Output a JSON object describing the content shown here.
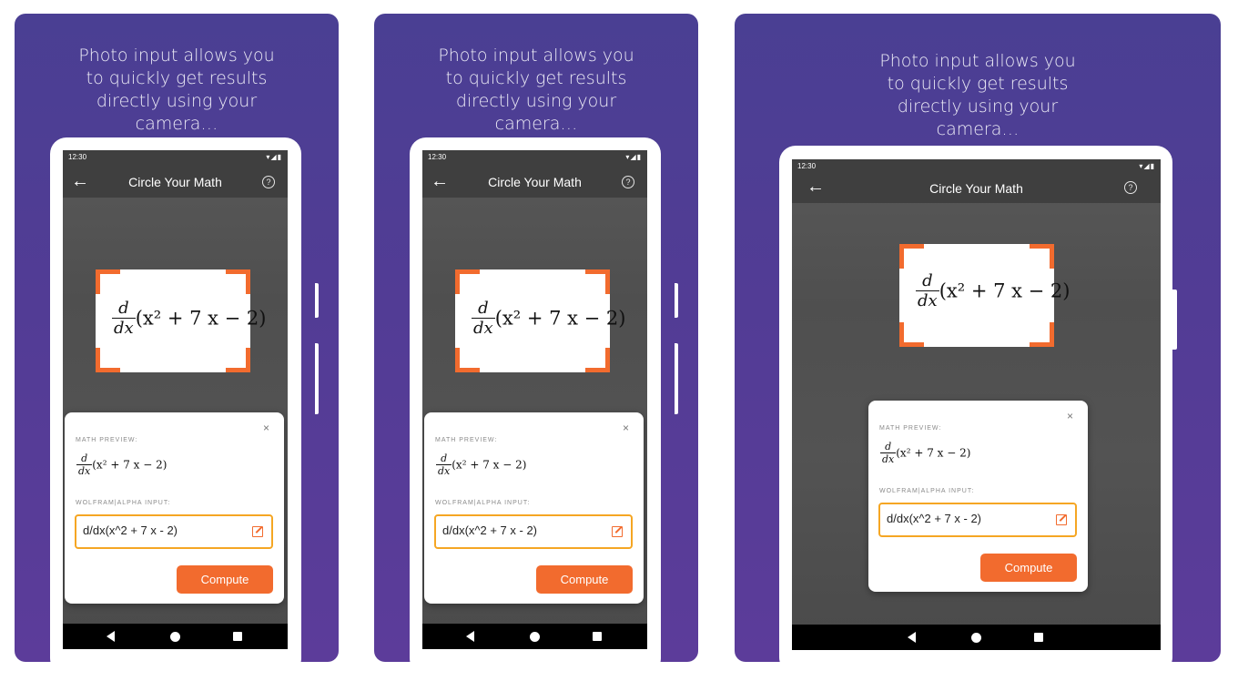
{
  "caption": "Photo input allows you to quickly get results directly using your camera…",
  "status": {
    "time": "12:30",
    "icons": "▾◢▮"
  },
  "toolbar": {
    "title": "Circle Your Math",
    "back_icon": "arrow-left-icon",
    "help_icon": "help-circle-icon",
    "help_glyph": "?"
  },
  "math": {
    "num": "d",
    "den": "dx",
    "expr": "(x² + 7 x − 2)"
  },
  "panel": {
    "close_glyph": "×",
    "preview_label": "MATH PREVIEW:",
    "input_label": "WOLFRAM|ALPHA INPUT:",
    "input_value": "d/dx(x^2 + 7 x - 2)",
    "compute_label": "Compute"
  },
  "colors": {
    "accent": "#f26b2e",
    "input_border": "#f5a623",
    "background": "#523c95"
  }
}
